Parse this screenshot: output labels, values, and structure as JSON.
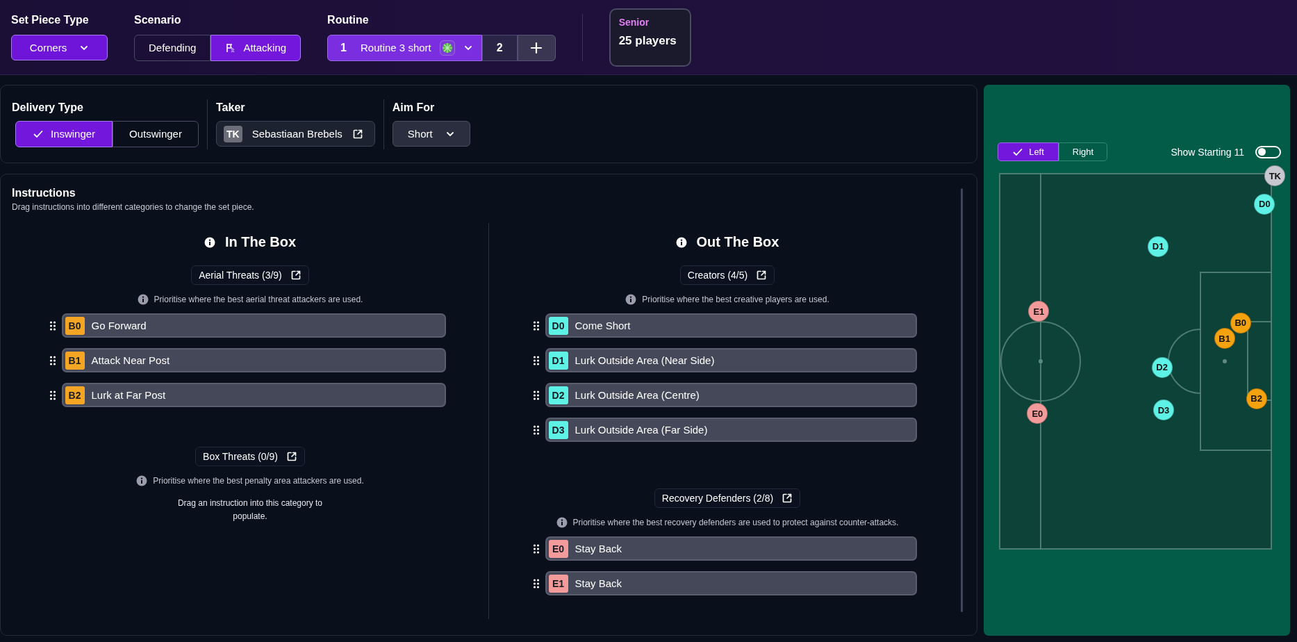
{
  "top_bar": {
    "set_piece_type": {
      "label": "Set Piece Type",
      "value": "Corners"
    },
    "scenario": {
      "label": "Scenario",
      "options": [
        {
          "label": "Defending",
          "selected": false
        },
        {
          "label": "Attacking",
          "selected": true
        }
      ]
    },
    "routine": {
      "label": "Routine",
      "tabs": [
        {
          "number": "1",
          "name": "Routine 3 short",
          "selected": true
        },
        {
          "number": "2",
          "selected": false
        }
      ]
    },
    "squad": {
      "label": "Senior",
      "count": "25 players"
    }
  },
  "delivery": {
    "delivery_type": {
      "label": "Delivery Type",
      "options": [
        {
          "label": "Inswinger",
          "selected": true
        },
        {
          "label": "Outswinger",
          "selected": false
        }
      ]
    },
    "taker": {
      "label": "Taker",
      "initials": "TK",
      "name": "Sebastiaan Brebels"
    },
    "aim_for": {
      "label": "Aim For",
      "value": "Short"
    }
  },
  "instructions": {
    "title": "Instructions",
    "subtitle": "Drag instructions into different categories to change the set piece.",
    "columns": [
      {
        "title": "In The Box",
        "groups": [
          {
            "name": "Aerial Threats (3/9)",
            "hint": "Prioritise where the best aerial threat attackers are used.",
            "items": [
              {
                "tag": "B0",
                "color": "#f5a524",
                "label": "Go Forward"
              },
              {
                "tag": "B1",
                "color": "#f5a524",
                "label": "Attack Near Post"
              },
              {
                "tag": "B2",
                "color": "#f5a524",
                "label": "Lurk at Far Post"
              }
            ]
          },
          {
            "name": "Box Threats (0/9)",
            "hint": "Prioritise where the best penalty area attackers are used.",
            "empty_text": "Drag an instruction into this category to populate."
          }
        ]
      },
      {
        "title": "Out The Box",
        "groups": [
          {
            "name": "Creators (4/5)",
            "hint": "Prioritise where the best creative players are used.",
            "items": [
              {
                "tag": "D0",
                "color": "#5ef2e6",
                "label": "Come Short"
              },
              {
                "tag": "D1",
                "color": "#5ef2e6",
                "label": "Lurk Outside Area (Near Side)"
              },
              {
                "tag": "D2",
                "color": "#5ef2e6",
                "label": "Lurk Outside Area (Centre)"
              },
              {
                "tag": "D3",
                "color": "#5ef2e6",
                "label": "Lurk Outside Area (Far Side)"
              }
            ]
          },
          {
            "name": "Recovery Defenders (2/8)",
            "hint": "Prioritise where the best recovery defenders are used to protect against counter-attacks.",
            "items": [
              {
                "tag": "E0",
                "color": "#f39a9a",
                "label": "Stay Back"
              },
              {
                "tag": "E1",
                "color": "#f39a9a",
                "label": "Stay Back"
              }
            ]
          }
        ]
      }
    ]
  },
  "pitch": {
    "sides": [
      {
        "label": "Left",
        "selected": true
      },
      {
        "label": "Right",
        "selected": false
      }
    ],
    "show_starting_11": {
      "label": "Show Starting 11",
      "on": false
    },
    "markers": [
      {
        "label": "TK",
        "color": "#c8c8d0"
      },
      {
        "label": "D0",
        "color": "#5ef2e6"
      },
      {
        "label": "D1",
        "color": "#5ef2e6"
      },
      {
        "label": "E1",
        "color": "#f39a9a"
      },
      {
        "label": "B0",
        "color": "#f5a20f"
      },
      {
        "label": "B1",
        "color": "#f5a20f"
      },
      {
        "label": "D2",
        "color": "#5ef2e6"
      },
      {
        "label": "B2",
        "color": "#f5a20f"
      },
      {
        "label": "D3",
        "color": "#5ef2e6"
      },
      {
        "label": "E0",
        "color": "#f39a9a"
      }
    ]
  }
}
